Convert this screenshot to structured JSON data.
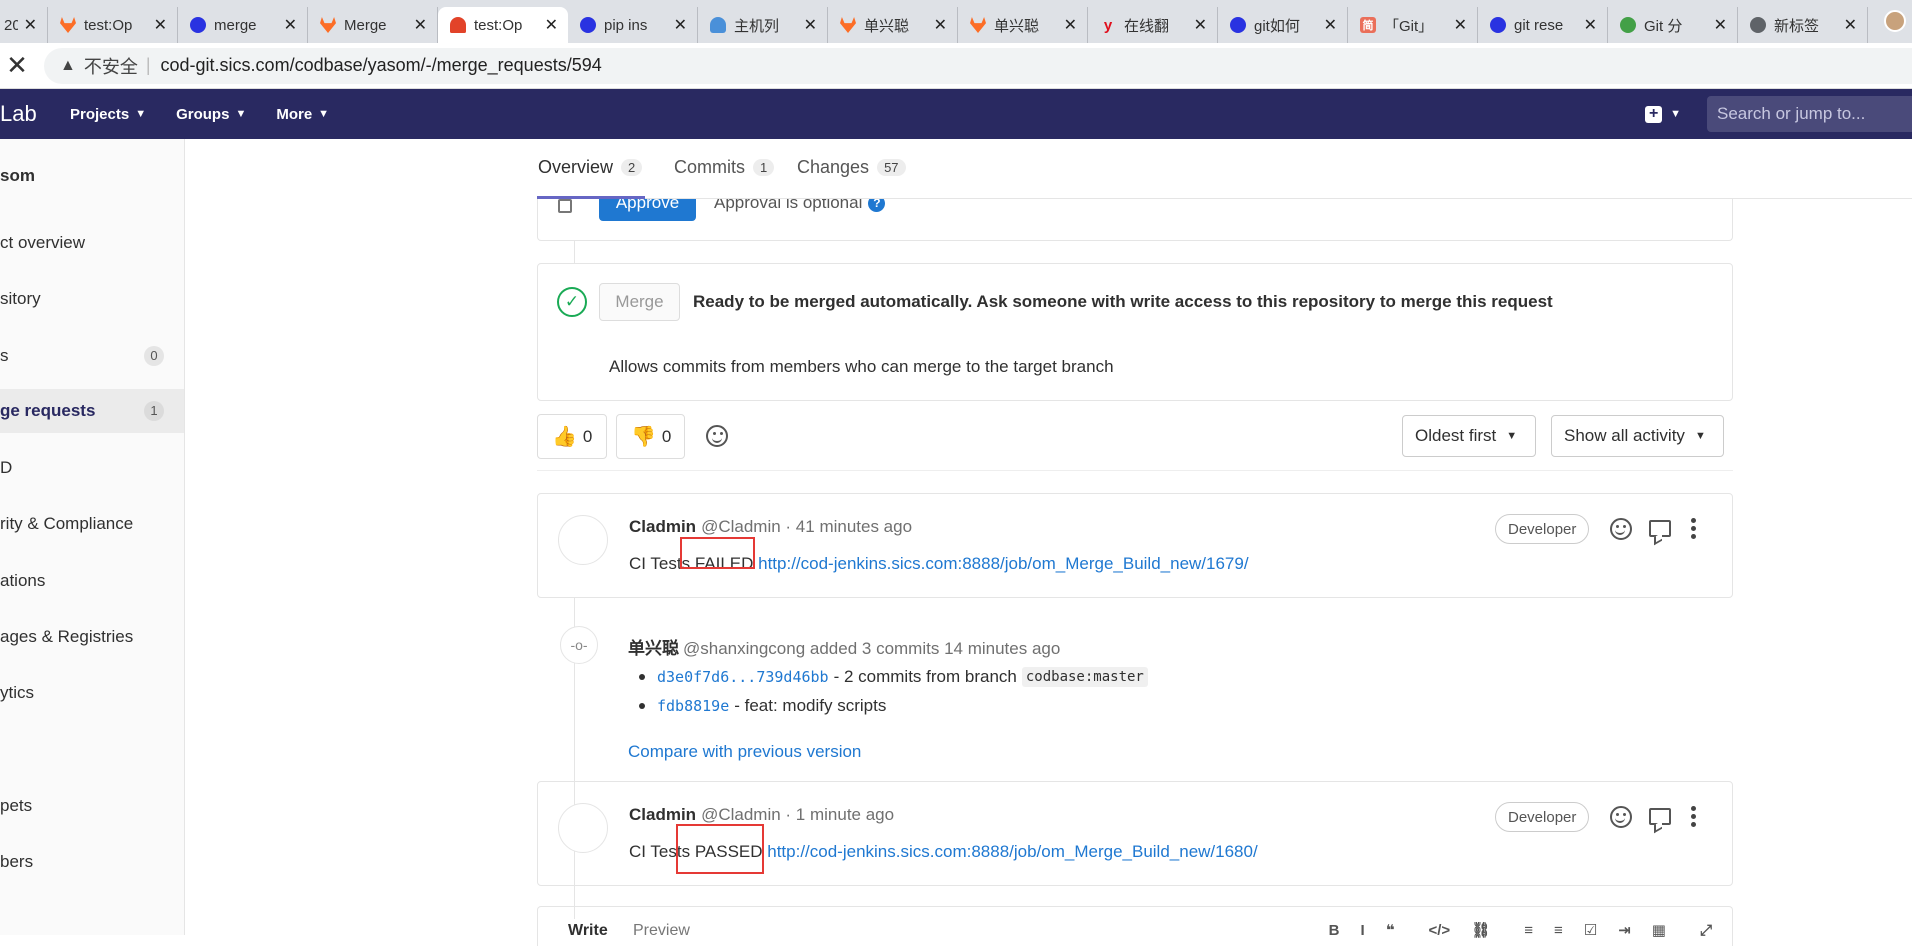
{
  "browser": {
    "tabs": [
      {
        "title": "20",
        "icon": "globe-icon"
      },
      {
        "title": "test:Op",
        "icon": "gitlab-icon"
      },
      {
        "title": "merge",
        "icon": "baidu-icon"
      },
      {
        "title": "Merge",
        "icon": "gitlab-icon"
      },
      {
        "title": "test:Op",
        "icon": "gitlab-icon",
        "active": true
      },
      {
        "title": "pip ins",
        "icon": "baidu-icon"
      },
      {
        "title": "主机列",
        "icon": "cloud-icon"
      },
      {
        "title": "单兴聪",
        "icon": "gitlab-icon"
      },
      {
        "title": "单兴聪",
        "icon": "gitlab-icon"
      },
      {
        "title": "在线翻",
        "icon": "youdao-icon"
      },
      {
        "title": "git如何",
        "icon": "baidu-icon"
      },
      {
        "title": "「Git」",
        "icon": "jianshu-icon"
      },
      {
        "title": "git rese",
        "icon": "baidu-icon"
      },
      {
        "title": "Git 分",
        "icon": "git-icon"
      },
      {
        "title": "新标签",
        "icon": "globe-icon"
      }
    ],
    "close_glyph": "✕",
    "security_label": "不安全",
    "url": "cod-git.sics.com/codbase/yasom/-/merge_requests/594"
  },
  "navbar": {
    "logo_text": "Lab",
    "items": [
      "Projects",
      "Groups",
      "More"
    ],
    "search_placeholder": "Search or jump to..."
  },
  "sidebar": {
    "project": "som",
    "items": [
      {
        "label": "ct overview"
      },
      {
        "label": "sitory"
      },
      {
        "label": "s",
        "count": "0"
      },
      {
        "label": "ge requests",
        "count": "1",
        "active": true
      },
      {
        "label": "D"
      },
      {
        "label": "rity & Compliance"
      },
      {
        "label": "ations"
      },
      {
        "label": "ages & Registries"
      },
      {
        "label": "ytics"
      },
      {
        "label": "pets"
      },
      {
        "label": "bers"
      }
    ]
  },
  "mr_tabs": [
    {
      "label": "Overview",
      "count": "2",
      "active": true
    },
    {
      "label": "Commits",
      "count": "1"
    },
    {
      "label": "Changes",
      "count": "57"
    }
  ],
  "approval": {
    "button": "Approve",
    "text": "Approval is optional",
    "info": "?"
  },
  "merge": {
    "button": "Merge",
    "message": "Ready to be merged automatically. Ask someone with write access to this repository to merge this request",
    "sub": "Allows commits from members who can merge to the target branch"
  },
  "awards": [
    {
      "emoji": "👍",
      "count": "0"
    },
    {
      "emoji": "👎",
      "count": "0"
    }
  ],
  "sort": {
    "label": "Oldest first"
  },
  "filter": {
    "label": "Show all activity"
  },
  "notes": [
    {
      "author": "Cladmin",
      "username": "@Cladmin",
      "time": "· 41 minutes ago",
      "body_prefix": "CI Tests FAILED ",
      "link": "http://cod-jenkins.sics.com:8888/job/om_Merge_Build_new/1679/",
      "role": "Developer"
    },
    {
      "author": "Cladmin",
      "username": "@Cladmin",
      "time": "· 1 minute ago",
      "body_prefix": "CI Tests PASSED ",
      "link": "http://cod-jenkins.sics.com:8888/job/om_Merge_Build_new/1680/",
      "role": "Developer"
    }
  ],
  "system_note": {
    "author": "单兴聪",
    "text": "@shanxingcong added 3 commits 14 minutes ago",
    "commits": [
      {
        "sha": "d3e0f7d6...739d46bb",
        "text": "- 2 commits from branch",
        "code": "codbase:master"
      },
      {
        "sha": "fdb8819e",
        "text": "- feat: modify scripts"
      }
    ],
    "compare": "Compare with previous version",
    "icon_glyph": "-o-"
  },
  "comment_form": {
    "write": "Write",
    "preview": "Preview",
    "toolbar": [
      "B",
      "I",
      "❝",
      "</>",
      "⛓",
      "≡",
      "≡",
      "☑",
      "⇥",
      "▦",
      "⤢"
    ]
  }
}
